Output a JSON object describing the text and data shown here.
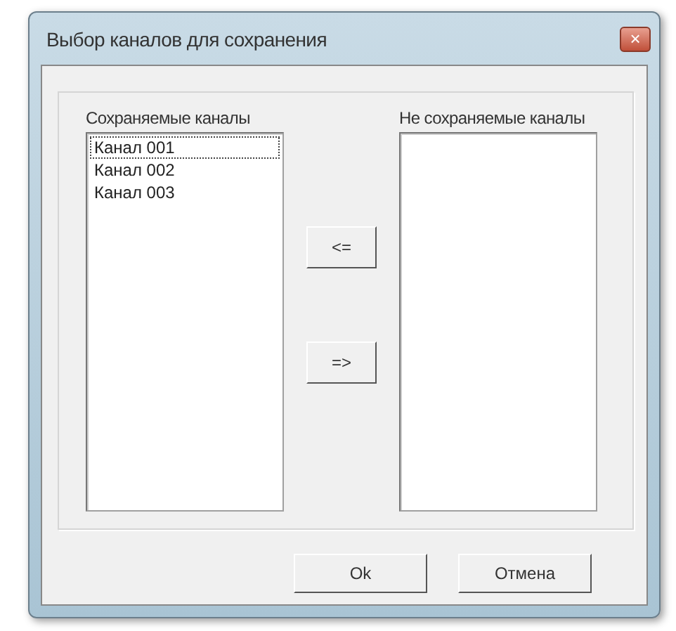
{
  "window": {
    "title": "Выбор каналов для сохранения",
    "close": "×"
  },
  "saved": {
    "label": "Сохраняемые каналы",
    "items": [
      {
        "text": "Канал 001",
        "focused": true
      },
      {
        "text": "Канал 002",
        "focused": false
      },
      {
        "text": "Канал 003",
        "focused": false
      }
    ]
  },
  "move_buttons": [
    "<=",
    "=>"
  ],
  "unsaved": {
    "label": "Не сохраняемые каналы"
  },
  "buttons": [
    "Ok",
    "Отмена"
  ]
}
